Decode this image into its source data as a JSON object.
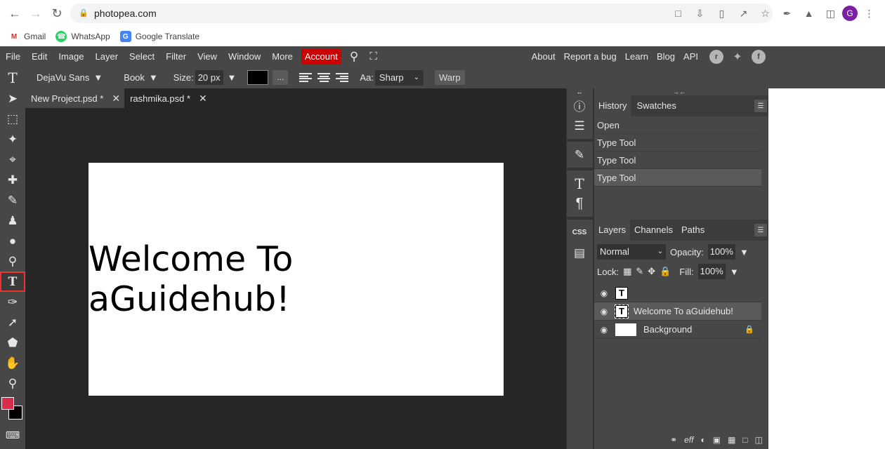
{
  "browser": {
    "url": "photopea.com",
    "profile_initial": "G",
    "bookmarks": [
      {
        "label": "Gmail",
        "icon": "gmail-icon",
        "color": "#d93025"
      },
      {
        "label": "WhatsApp",
        "icon": "whatsapp-icon",
        "color": "#25d366"
      },
      {
        "label": "Google Translate",
        "icon": "translate-icon",
        "color": "#4285f4"
      }
    ]
  },
  "menu": {
    "items": [
      "File",
      "Edit",
      "Image",
      "Layer",
      "Select",
      "Filter",
      "View",
      "Window",
      "More"
    ],
    "account": "Account",
    "right_links": [
      "About",
      "Report a bug",
      "Learn",
      "Blog",
      "API"
    ]
  },
  "options": {
    "font_family": "DejaVu Sans",
    "font_style": "Book",
    "size_label": "Size:",
    "size_value": "20 px",
    "more_label": "...",
    "aa_label": "Aa:",
    "aa_value": "Sharp",
    "warp_label": "Warp"
  },
  "colors": {
    "foreground": "#d92b4b",
    "background": "#000000",
    "accent": "#cc0000"
  },
  "document": {
    "tabs": [
      {
        "label": "New Project.psd *",
        "active": false
      },
      {
        "label": "rashmika.psd *",
        "active": true
      }
    ],
    "canvas_text": "Welcome To aGuidehub!"
  },
  "history": {
    "tabs": [
      "History",
      "Swatches"
    ],
    "items": [
      "Open",
      "Type Tool",
      "Type Tool",
      "Type Tool"
    ]
  },
  "layers": {
    "tabs": [
      "Layers",
      "Channels",
      "Paths"
    ],
    "blend_mode": "Normal",
    "opacity_label": "Opacity:",
    "opacity_value": "100%",
    "lock_label": "Lock:",
    "fill_label": "Fill:",
    "fill_value": "100%",
    "items": [
      {
        "name": "",
        "type": "text"
      },
      {
        "name": "Welcome To aGuidehub!",
        "type": "text"
      },
      {
        "name": "Background",
        "type": "background"
      }
    ],
    "footer_eff": "eff"
  }
}
